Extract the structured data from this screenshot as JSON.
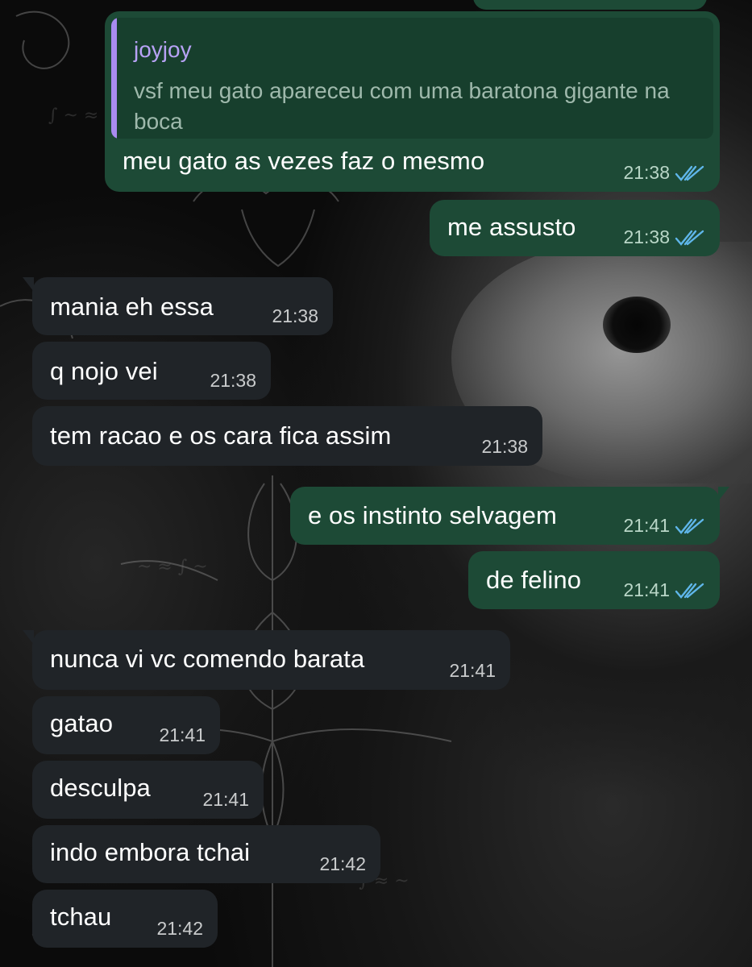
{
  "colors": {
    "outgoing_bubble": "#1d4a36",
    "incoming_bubble": "#202428",
    "quote_accent": "#a98bf0",
    "read_ticks": "#5fb6ea"
  },
  "reply_quote": {
    "author": "joyjoy",
    "text": "vsf meu gato apareceu com uma baratona gigante na boca"
  },
  "messages": [
    {
      "direction": "out",
      "text": "meu gato as vezes faz o mesmo",
      "time": "21:38",
      "status": "read"
    },
    {
      "direction": "out",
      "text": "me assusto",
      "time": "21:38",
      "status": "read"
    },
    {
      "direction": "in",
      "text": "mania eh essa",
      "time": "21:38"
    },
    {
      "direction": "in",
      "text": "q nojo vei",
      "time": "21:38"
    },
    {
      "direction": "in",
      "text": "tem racao e os cara fica assim",
      "time": "21:38"
    },
    {
      "direction": "out",
      "text": "e os instinto selvagem",
      "time": "21:41",
      "status": "read"
    },
    {
      "direction": "out",
      "text": "de felino",
      "time": "21:41",
      "status": "read"
    },
    {
      "direction": "in",
      "text": "nunca vi vc comendo barata",
      "time": "21:41"
    },
    {
      "direction": "in",
      "text": "gatao",
      "time": "21:41"
    },
    {
      "direction": "in",
      "text": "desculpa",
      "time": "21:41"
    },
    {
      "direction": "in",
      "text": "indo embora tchai",
      "time": "21:42"
    },
    {
      "direction": "in",
      "text": "tchau",
      "time": "21:42"
    }
  ]
}
